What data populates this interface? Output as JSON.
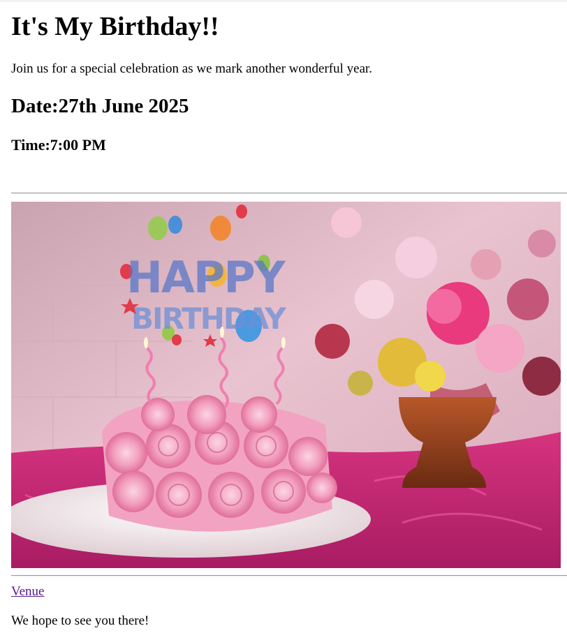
{
  "page": {
    "title": "It's My Birthday!!",
    "intro": "Join us for a special celebration as we mark another wonderful year.",
    "date": "Date:27th June 2025",
    "time": "Time:7:00 PM",
    "venue_link": "Venue",
    "closing": "We hope to see you there!"
  },
  "image": {
    "sign_line1": "HAPPY",
    "sign_line2": "BIRTHDAY",
    "description_icon": "birthday-cake-photo"
  },
  "colors": {
    "link_visited": "#551a8b",
    "text": "#000000",
    "background": "#ffffff"
  }
}
